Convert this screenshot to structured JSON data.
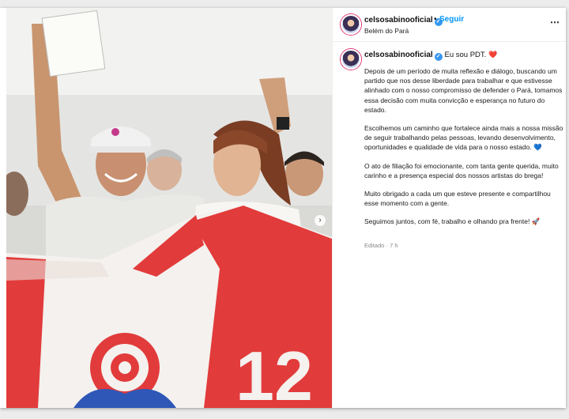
{
  "post": {
    "username": "celsosabinooficial",
    "follow_label": "Seguir",
    "separator": "•",
    "location": "Belém do Pará",
    "more_icon": "⋯",
    "caption_heading": "Eu sou PDT.",
    "caption_heading_emoji": "❤️",
    "paragraphs": [
      "Depois de um período de muita reflexão e diálogo, buscando um partido que nos desse liberdade para trabalhar e que estivesse alinhado com o nosso compromisso de defender o Pará, tomamos essa decisão com muita convicção e esperança no futuro do estado.",
      "Escolhemos um caminho que fortalece ainda mais a nossa missão de seguir trabalhando pelas pessoas, levando desenvolvimento, oportunidades e qualidade de vida para o nosso estado.",
      "O ato de filiação foi emocionante, com tanta gente querida, muito carinho e a presença especial dos nossos artistas do brega!",
      "Muito obrigado a cada um que esteve presente e compartilhou esse momento com a gente.",
      "Seguimos juntos, com fé, trabalho e olhando pra frente!"
    ],
    "blue_heart_emoji": "💙",
    "rocket_emoji": "🚀",
    "edited_label": "Editado",
    "timestamp": "7 h",
    "flag_number": "12",
    "carousel_next": "›"
  },
  "colors": {
    "flag_red": "#e23b3b",
    "flag_white": "#f4f1ee",
    "rose_blue": "#2f57b7",
    "link_blue": "#0095f6"
  }
}
